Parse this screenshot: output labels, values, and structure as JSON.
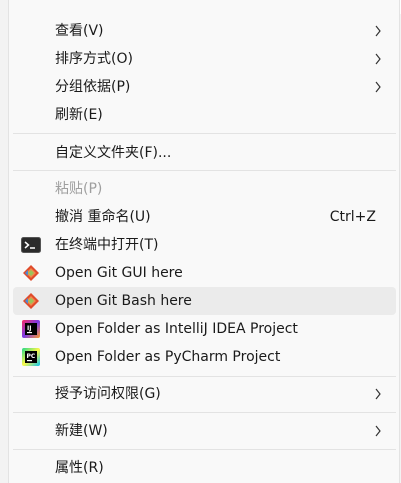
{
  "menu": {
    "items": [
      {
        "label": "查看(V)",
        "submenu": true
      },
      {
        "label": "排序方式(O)",
        "submenu": true
      },
      {
        "label": "分组依据(P)",
        "submenu": true
      },
      {
        "label": "刷新(E)"
      },
      {
        "label": "自定义文件夹(F)..."
      },
      {
        "label": "粘贴(P)",
        "disabled": true
      },
      {
        "label": "撤消 重命名(U)",
        "shortcut": "Ctrl+Z"
      },
      {
        "label": "在终端中打开(T)",
        "icon": "terminal-icon"
      },
      {
        "label": "Open Git GUI here",
        "icon": "git-icon"
      },
      {
        "label": "Open Git Bash here",
        "icon": "git-icon"
      },
      {
        "label": "Open Folder as IntelliJ IDEA Project",
        "icon": "intellij-icon"
      },
      {
        "label": "Open Folder as PyCharm Project",
        "icon": "pycharm-icon"
      },
      {
        "label": "授予访问权限(G)",
        "submenu": true
      },
      {
        "label": "新建(W)",
        "submenu": true
      },
      {
        "label": "属性(R)"
      }
    ]
  },
  "colors": {
    "menu_bg": "#f9f9f9",
    "hover_bg": "#ebebeb",
    "text": "#1a1a1a",
    "disabled_text": "#9f9f9f",
    "separator": "#e3e3e3"
  }
}
